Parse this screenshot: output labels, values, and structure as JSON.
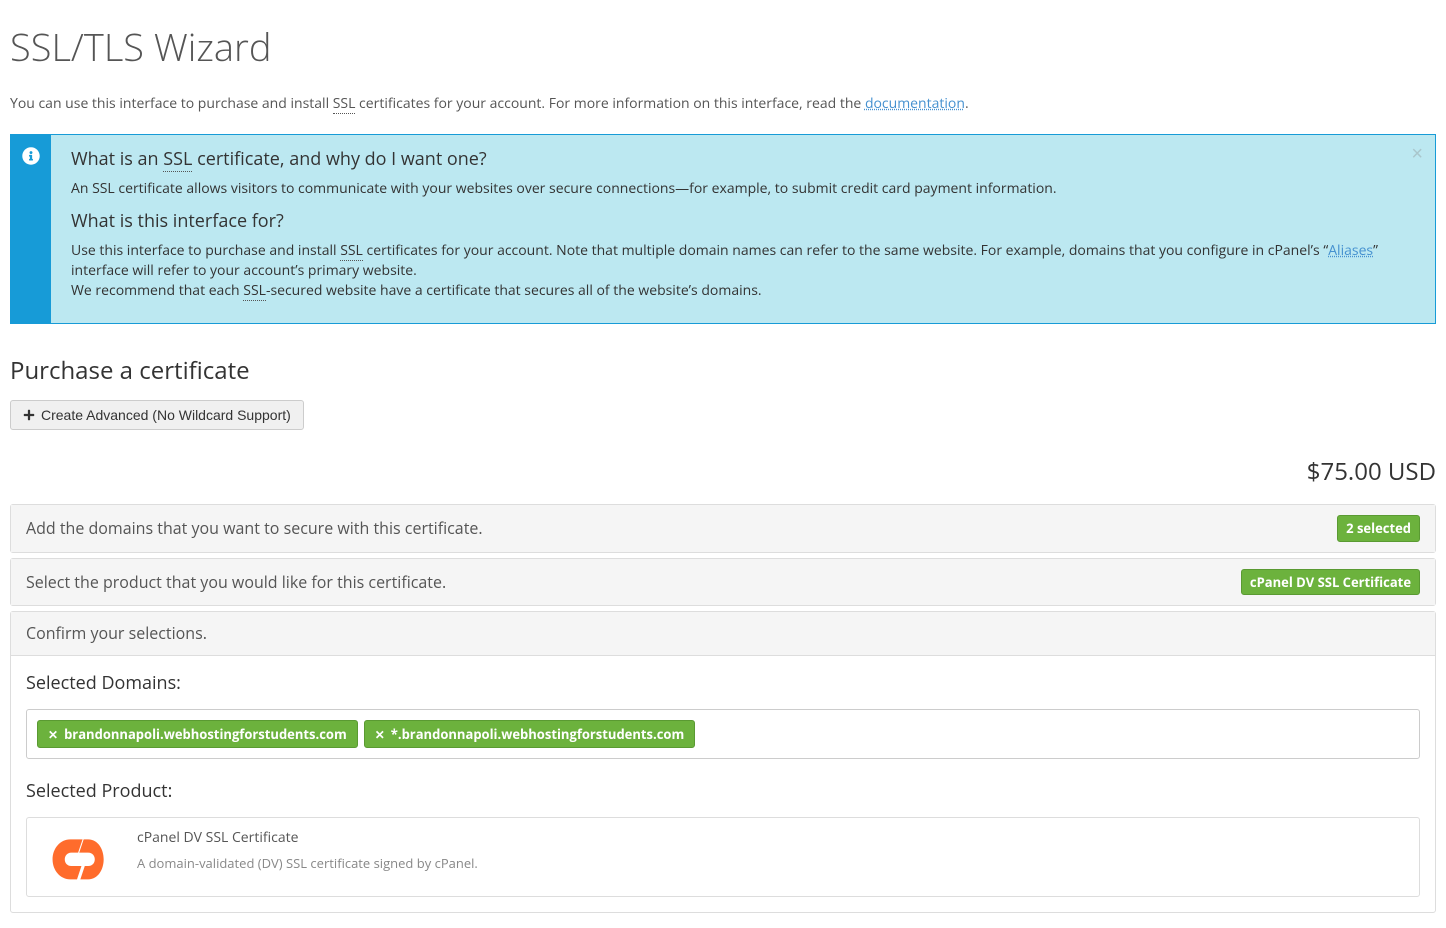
{
  "page_title": "SSL/TLS Wizard",
  "intro": {
    "prefix": "You can use this interface to purchase and install ",
    "ssl_abbr": "SSL",
    "middle": " certificates for your account. For more information on this interface, read the ",
    "link_text": "documentation",
    "suffix": "."
  },
  "info_box": {
    "q1_before": "What is an ",
    "q1_ssl": "SSL",
    "q1_after": " certificate, and why do I want one?",
    "a1": "An SSL certificate allows visitors to communicate with your websites over secure connections—for example, to submit credit card payment information.",
    "q2": "What is this interface for?",
    "a2_before": "Use this interface to purchase and install ",
    "a2_ssl": "SSL",
    "a2_mid": " certificates for your account. Note that multiple domain names can refer to the same website. For example, domains that you configure in cPanel’s “",
    "a2_link": "Aliases",
    "a2_after_link": "” interface will refer to your account’s primary website.",
    "a2_line3_before": "We recommend that each ",
    "a2_line3_ssl": "SSL",
    "a2_line3_after": "-secured website have a certificate that secures all of the website’s domains.",
    "close": "×"
  },
  "purchase": {
    "heading": "Purchase a certificate",
    "create_btn": "Create Advanced (No Wildcard Support)",
    "price": "$75.00 USD"
  },
  "steps": {
    "step1_label": "Add the domains that you want to secure with this certificate.",
    "step1_badge": "2 selected",
    "step2_label": "Select the product that you would like for this certificate.",
    "step2_badge": "cPanel DV SSL Certificate",
    "step3_label": "Confirm your selections."
  },
  "confirm": {
    "sel_domains_heading": "Selected Domains:",
    "domains": [
      "brandonnapoli.webhostingforstudents.com",
      "*.brandonnapoli.webhostingforstudents.com"
    ],
    "sel_product_heading": "Selected Product:",
    "product_name": "cPanel DV SSL Certificate",
    "product_desc": "A domain-validated (DV) SSL certificate signed by cPanel."
  }
}
